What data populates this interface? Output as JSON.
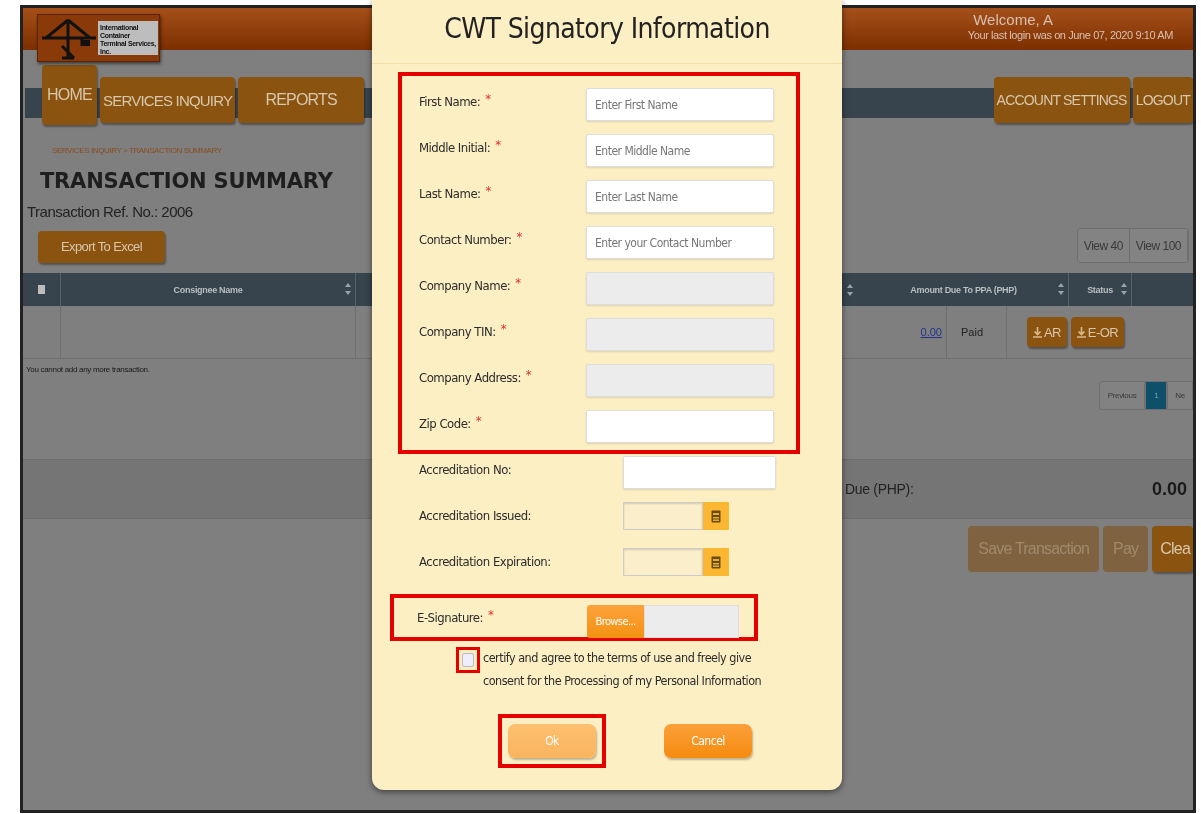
{
  "header": {
    "logo_text": "International Container Terminal Services, Inc.",
    "welcome": "Welcome, A",
    "last_login": "Your last login was on June 07, 2020 9:10 AM"
  },
  "nav": {
    "left": [
      {
        "label": "HOME",
        "selected": true
      },
      {
        "label": "SERVICES INQUIRY",
        "selected": false
      },
      {
        "label": "REPORTS",
        "selected": false
      }
    ],
    "right": [
      {
        "label": "ACCOUNT SETTINGS",
        "selected": false
      },
      {
        "label": "LOGOUT",
        "selected": false
      }
    ]
  },
  "breadcrumb": "SERVICES INQUIRY > TRANSACTION SUMMARY",
  "page_title": "TRANSACTION SUMMARY",
  "reference": "Transaction Ref. No.: 2006",
  "export_button": "Export To Excel",
  "view_buttons": [
    "View 40",
    "View 100"
  ],
  "table": {
    "select_all_checked": false,
    "columns": [
      {
        "label": "Consignee Name"
      },
      {
        "label": "Amount Due To PPA (PHP)"
      },
      {
        "label": "Status"
      }
    ],
    "rows": [
      {
        "amount": "0.00",
        "status": "Paid",
        "actions": [
          "AR",
          "E-OR"
        ]
      }
    ]
  },
  "note": "You cannot add any more transaction.",
  "pagination": [
    {
      "label": "Previous",
      "selected": false
    },
    {
      "label": "1",
      "selected": true
    },
    {
      "label": "Ne",
      "selected": false
    }
  ],
  "total": {
    "label": "Due (PHP):",
    "value": "0.00"
  },
  "actions": [
    {
      "label": "Save Transaction",
      "disabled": true
    },
    {
      "label": "Pay",
      "disabled": true
    },
    {
      "label": "Clea",
      "disabled": false
    }
  ],
  "modal": {
    "title": "CWT Signatory Information",
    "required_group": {
      "highlighted": true,
      "fields": [
        {
          "label": "First Name:",
          "marker": "*",
          "kind": "text",
          "placeholder": "Enter First Name"
        },
        {
          "label": "Middle Initial:",
          "marker": "*",
          "kind": "text",
          "placeholder": "Enter Middle Name"
        },
        {
          "label": "Last Name:",
          "marker": "*",
          "kind": "text",
          "placeholder": "Enter Last Name"
        },
        {
          "label": "Contact Number:",
          "marker": "*",
          "kind": "text",
          "placeholder": "Enter your Contact Number"
        },
        {
          "label": "Company Name:",
          "marker": "*",
          "kind": "readonly"
        },
        {
          "label": "Company TIN:",
          "marker": "*",
          "kind": "readonly"
        },
        {
          "label": "Company Address:",
          "marker": "*",
          "kind": "readonly"
        },
        {
          "label": "Zip Code:",
          "marker": "*",
          "kind": "text"
        }
      ]
    },
    "other_fields": [
      {
        "label": "Accreditation No:",
        "kind": "text"
      },
      {
        "label": "Accreditation Issued:",
        "kind": "date"
      },
      {
        "label": "Accreditation Expiration:",
        "kind": "date"
      }
    ],
    "signature": {
      "label": "E-Signature:",
      "marker": "*",
      "button": "Browse...",
      "highlighted": true
    },
    "consent": {
      "checked": false,
      "highlighted": true,
      "text": "certify and agree to the terms of use and freely give consent for the Processing of my Personal Information"
    },
    "buttons": [
      {
        "label": "Ok",
        "kind": "primary",
        "disabled": true,
        "highlighted": true
      },
      {
        "label": "Cancel",
        "kind": "secondary",
        "disabled": false,
        "highlighted": false
      }
    ]
  }
}
